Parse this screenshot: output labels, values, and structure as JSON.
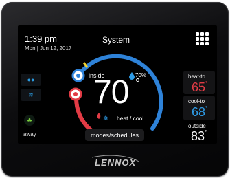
{
  "status": {
    "time": "1:39 pm",
    "date": "Mon | Jun 12, 2017",
    "title": "System"
  },
  "dial": {
    "inside_label": "inside",
    "humidity": "70%",
    "temperature": "70",
    "degree_symbol": "°",
    "mode": "heat / cool"
  },
  "setpoints": {
    "heat_label": "heat-to",
    "heat_value": "65",
    "cool_label": "cool-to",
    "cool_value": "68",
    "outside_label": "outside",
    "outside_value": "83"
  },
  "sidebar": {
    "away_label": "away"
  },
  "modes_button": "modes/schedules",
  "brand": "LENNOX",
  "colors": {
    "heat": "#e23b45",
    "cool": "#2e9be6",
    "away": "#7ccf3d"
  }
}
